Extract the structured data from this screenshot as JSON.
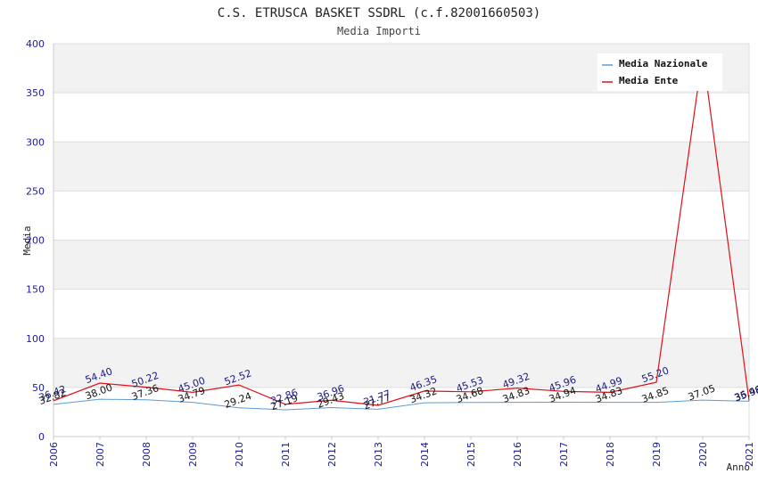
{
  "chart_data": {
    "type": "line",
    "title": "C.S. ETRUSCA BASKET SSDRL (c.f.82001660503)",
    "subtitle": "Media Importi",
    "xlabel": "Anno",
    "ylabel": "Media",
    "x": [
      "2006",
      "2007",
      "2008",
      "2009",
      "2010",
      "2011",
      "2012",
      "2013",
      "2014",
      "2015",
      "2016",
      "2017",
      "2018",
      "2019",
      "2020",
      "2021"
    ],
    "ylim": [
      0,
      400
    ],
    "yticks": [
      0,
      50,
      100,
      150,
      200,
      250,
      300,
      350,
      400
    ],
    "legend_position": "top-right",
    "series": [
      {
        "name": "Media Nazionale",
        "color": "#5b9bd5",
        "values": [
          32.82,
          38.0,
          37.36,
          34.79,
          29.24,
          27.19,
          29.43,
          27.77,
          34.32,
          34.68,
          34.83,
          34.94,
          34.83,
          34.85,
          37.05,
          35.98
        ],
        "labels": [
          "32.82",
          "38.00",
          "37.36",
          "34.79",
          "29.24",
          "27.19",
          "29.43",
          "27.77",
          "34.32",
          "34.68",
          "34.83",
          "34.94",
          "34.83",
          "34.85",
          "37.05",
          "35.98"
        ]
      },
      {
        "name": "Media Ente",
        "color": "#e0101a",
        "values": [
          36.42,
          54.4,
          50.22,
          45.0,
          52.52,
          32.86,
          36.96,
          31.77,
          46.35,
          45.53,
          49.32,
          45.96,
          44.99,
          55.2,
          390.0,
          36.46
        ],
        "labels": [
          "36.42",
          "54.40",
          "50.22",
          "45.00",
          "52.52",
          "32.86",
          "36.96",
          "31.77",
          "46.35",
          "45.53",
          "49.32",
          "45.96",
          "44.99",
          "55.20",
          "",
          "36.46"
        ]
      }
    ]
  }
}
